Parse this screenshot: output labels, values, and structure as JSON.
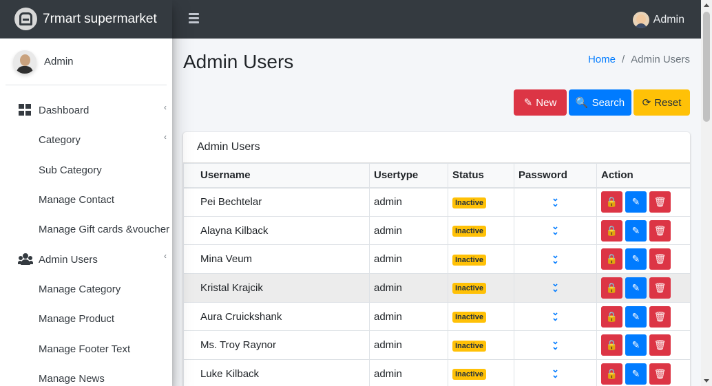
{
  "brand": {
    "name": "7rmart supermarket"
  },
  "navbar": {
    "user_name": "Admin"
  },
  "sidebar": {
    "user_name": "Admin",
    "items": [
      {
        "label": "Dashboard",
        "icon": "dashboard-icon",
        "has_caret": true
      },
      {
        "label": "Category",
        "has_caret": true
      },
      {
        "label": "Sub Category"
      },
      {
        "label": "Manage Contact"
      },
      {
        "label": "Manage Gift cards &voucher"
      },
      {
        "label": "Admin Users",
        "icon": "users-icon",
        "has_caret": true
      },
      {
        "label": "Manage Category"
      },
      {
        "label": "Manage Product"
      },
      {
        "label": "Manage Footer Text"
      },
      {
        "label": "Manage News"
      }
    ]
  },
  "page": {
    "title": "Admin Users",
    "breadcrumb": {
      "home": "Home",
      "separator": "/",
      "current": "Admin Users"
    }
  },
  "toolbar": {
    "new_label": "New",
    "search_label": "Search",
    "reset_label": "Reset"
  },
  "card": {
    "title": "Admin Users",
    "columns": [
      "Username",
      "Usertype",
      "Status",
      "Password",
      "Action"
    ],
    "rows": [
      {
        "username": "Pei Bechtelar",
        "usertype": "admin",
        "status": "Inactive"
      },
      {
        "username": "Alayna Kilback",
        "usertype": "admin",
        "status": "Inactive"
      },
      {
        "username": "Mina Veum",
        "usertype": "admin",
        "status": "Inactive"
      },
      {
        "username": "Kristal Krajcik",
        "usertype": "admin",
        "status": "Inactive"
      },
      {
        "username": "Aura Cruickshank",
        "usertype": "admin",
        "status": "Inactive"
      },
      {
        "username": "Ms. Troy Raynor",
        "usertype": "admin",
        "status": "Inactive"
      },
      {
        "username": "Luke Kilback",
        "usertype": "admin",
        "status": "Inactive"
      }
    ]
  },
  "colors": {
    "navbar": "#343a40",
    "danger": "#dc3545",
    "primary": "#007bff",
    "warning": "#ffc107"
  }
}
